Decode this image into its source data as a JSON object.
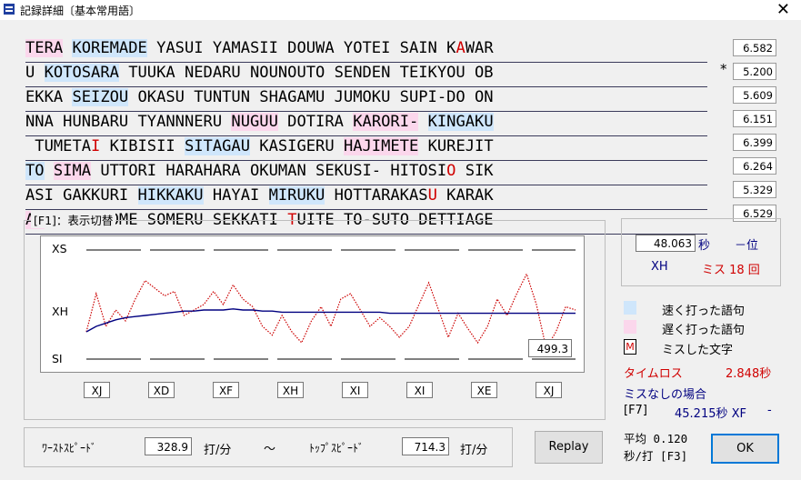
{
  "window": {
    "title": "記録詳細〔基本常用語〕",
    "close": "✕"
  },
  "lines": [
    [
      {
        "t": "TERA",
        "c": "slow"
      },
      {
        "t": " "
      },
      {
        "t": "KOREMADE",
        "c": "fast"
      },
      {
        "t": " YASUI YAMASII DOUWA YOTEI SAIN K"
      },
      {
        "t": "A",
        "c": "miss"
      },
      {
        "t": "WAR"
      }
    ],
    [
      {
        "t": "U"
      },
      {
        "t": " "
      },
      {
        "t": "KOTOSARA",
        "c": "fast"
      },
      {
        "t": " TUUKA NEDARU NOUNOUTO SENDEN TEIKYOU OB"
      }
    ],
    [
      {
        "t": "EKKA "
      },
      {
        "t": "SEIZOU",
        "c": "fast"
      },
      {
        "t": " OKASU TUNTUN SHAGAMU JUMOKU SUPI-DO ON"
      }
    ],
    [
      {
        "t": "NNA HUNBARU TYANNNERU "
      },
      {
        "t": "NUGUU",
        "c": "slow"
      },
      {
        "t": " DOTIRA "
      },
      {
        "t": "KARORI-",
        "c": "slow"
      },
      {
        "t": " "
      },
      {
        "t": "KINGAKU",
        "c": "fast"
      }
    ],
    [
      {
        "t": " TUMETA"
      },
      {
        "t": "I",
        "c": "miss"
      },
      {
        "t": " KIBISII "
      },
      {
        "t": "SITAGAU",
        "c": "fast"
      },
      {
        "t": " KASIGERU "
      },
      {
        "t": "HAJIMETE",
        "c": "slow"
      },
      {
        "t": " KUREJIT"
      }
    ],
    [
      {
        "t": "TO",
        "c": "fast"
      },
      {
        "t": " "
      },
      {
        "t": "SIMA",
        "c": "slow"
      },
      {
        "t": " UTTORI HARAHARA OKUMAN SEKUSI- HITOSI"
      },
      {
        "t": "O",
        "c": "miss"
      },
      {
        "t": " SIK"
      }
    ],
    [
      {
        "t": "ASI GAKKURI "
      },
      {
        "t": "HIKKAKU",
        "c": "fast"
      },
      {
        "t": " HAYAI "
      },
      {
        "t": "MIRUKU",
        "c": "fast"
      },
      {
        "t": " HOTTARAKAS"
      },
      {
        "t": "U",
        "c": "miss"
      },
      {
        "t": " KARAK"
      }
    ],
    [
      {
        "t": "AU",
        "c": "slow"
      },
      {
        "t": " NIOI "
      },
      {
        "t": "K",
        "c": "miss"
      },
      {
        "t": "OME SOMERU SEKKATI "
      },
      {
        "t": "T",
        "c": "miss"
      },
      {
        "t": "UITE TO-SUTO DETTIAGE"
      }
    ]
  ],
  "line_scores": [
    "6.582",
    "5.200",
    "5.609",
    "6.151",
    "6.399",
    "6.264",
    "5.329",
    "6.529"
  ],
  "worst_marker": "*",
  "graph": {
    "group_label": "[F1]：表示切替",
    "y_labels": [
      "XS",
      "XH",
      "SI"
    ],
    "x_labels": [
      "XJ",
      "XD",
      "XF",
      "XH",
      "XI",
      "XI",
      "XE",
      "XJ"
    ],
    "current_value": "499.3"
  },
  "chart_data": {
    "type": "line",
    "title": "",
    "y_range_ticks": [
      "SI",
      "XH",
      "XS"
    ],
    "x": [
      0.0,
      0.02,
      0.04,
      0.06,
      0.08,
      0.1,
      0.12,
      0.14,
      0.16,
      0.18,
      0.2,
      0.22,
      0.24,
      0.26,
      0.28,
      0.3,
      0.32,
      0.34,
      0.36,
      0.38,
      0.4,
      0.42,
      0.44,
      0.46,
      0.48,
      0.5,
      0.52,
      0.54,
      0.56,
      0.58,
      0.6,
      0.62,
      0.64,
      0.66,
      0.68,
      0.7,
      0.72,
      0.74,
      0.76,
      0.78,
      0.8,
      0.82,
      0.84,
      0.86,
      0.88,
      0.9,
      0.92,
      0.94,
      0.96,
      0.98,
      1.0
    ],
    "series": [
      {
        "name": "",
        "color": "#cc0000",
        "style": "dotted",
        "values": [
          0.25,
          0.6,
          0.3,
          0.45,
          0.35,
          0.55,
          0.72,
          0.65,
          0.58,
          0.62,
          0.4,
          0.45,
          0.5,
          0.62,
          0.5,
          0.68,
          0.55,
          0.48,
          0.3,
          0.22,
          0.4,
          0.25,
          0.15,
          0.35,
          0.48,
          0.3,
          0.55,
          0.6,
          0.45,
          0.3,
          0.38,
          0.3,
          0.2,
          0.3,
          0.5,
          0.7,
          0.45,
          0.2,
          0.42,
          0.28,
          0.15,
          0.3,
          0.55,
          0.4,
          0.6,
          0.78,
          0.5,
          0.1,
          0.25,
          0.48,
          0.45
        ]
      },
      {
        "name": "",
        "color": "#000080",
        "style": "solid",
        "values": [
          0.25,
          0.3,
          0.33,
          0.36,
          0.38,
          0.39,
          0.4,
          0.41,
          0.42,
          0.43,
          0.44,
          0.44,
          0.45,
          0.45,
          0.45,
          0.46,
          0.45,
          0.45,
          0.44,
          0.44,
          0.43,
          0.43,
          0.43,
          0.43,
          0.43,
          0.43,
          0.43,
          0.43,
          0.43,
          0.43,
          0.43,
          0.42,
          0.42,
          0.42,
          0.42,
          0.42,
          0.42,
          0.42,
          0.42,
          0.42,
          0.42,
          0.42,
          0.42,
          0.42,
          0.42,
          0.42,
          0.42,
          0.42,
          0.42,
          0.42,
          0.42
        ]
      }
    ]
  },
  "result": {
    "time": "48.063",
    "time_unit": "秒",
    "rank": "－位",
    "grade": "XH",
    "miss": "ミス 18 回"
  },
  "legend": {
    "fast": "速く打った語句",
    "slow": "遅く打った語句",
    "miss_marker": "M",
    "miss": "ミスした文字",
    "fast_color": "#cfe6fb",
    "slow_color": "#fbd7ec"
  },
  "timeloss": {
    "label": "タイムロス",
    "value": "2.848秒"
  },
  "nomiss": {
    "label": "ミスなしの場合",
    "key": "[F7]",
    "value": "45.215秒 XF",
    "rank": "-"
  },
  "speed": {
    "worst_label": "ﾜｰｽﾄｽﾋﾟｰﾄﾞ",
    "worst": "328.9",
    "top_label": "ﾄｯﾌﾟｽﾋﾟｰﾄﾞ",
    "top": "714.3",
    "unit": "打/分",
    "tilde": "〜"
  },
  "average": {
    "line1": "平均 0.120",
    "line2": "秒/打 [F3]"
  },
  "buttons": {
    "replay": "Replay",
    "ok": "OK"
  }
}
